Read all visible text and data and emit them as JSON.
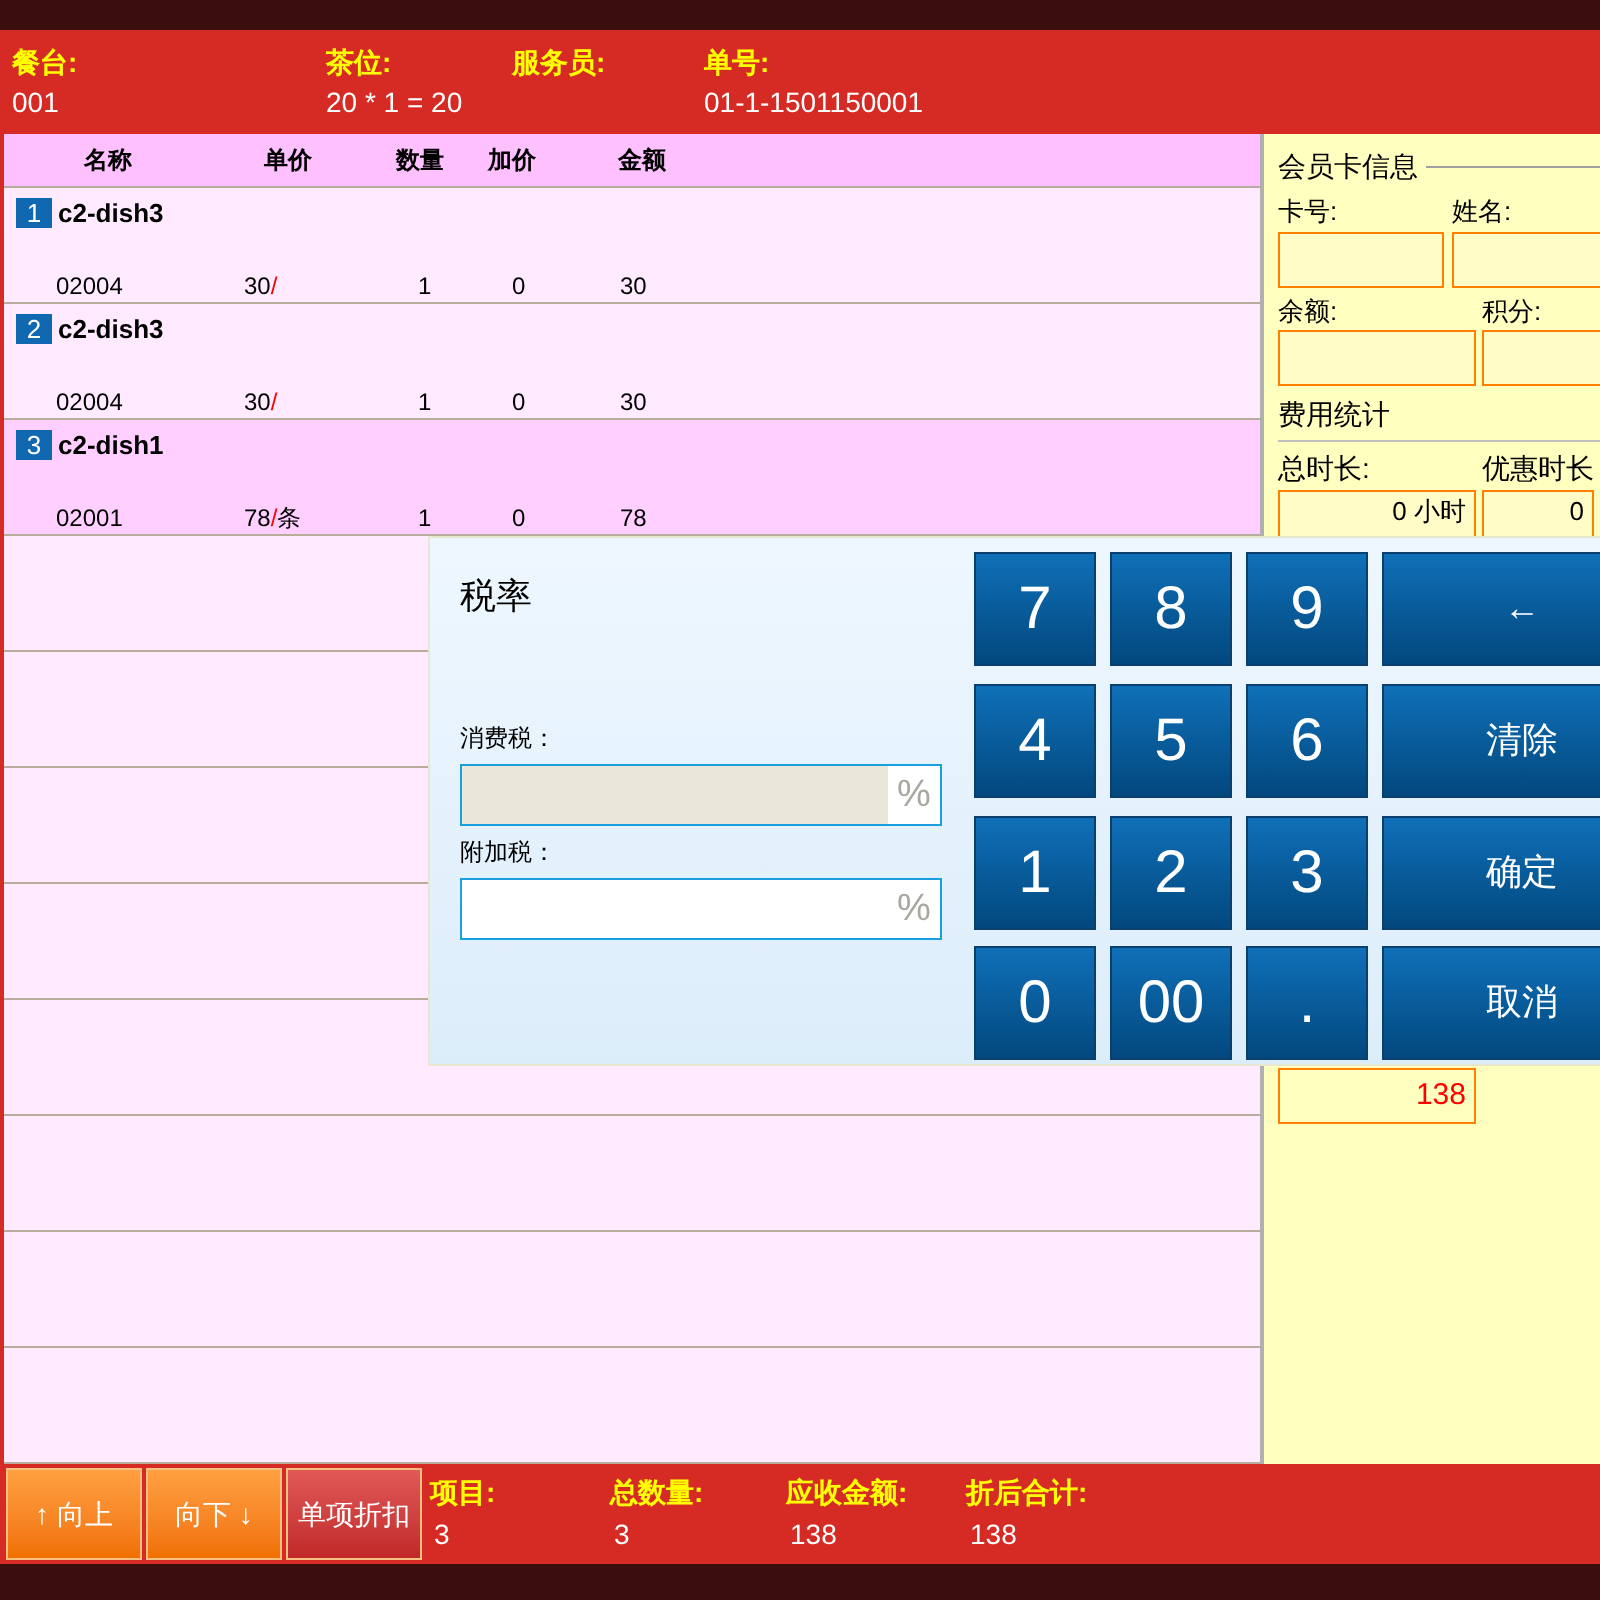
{
  "header": [
    {
      "label": "餐台:",
      "value": "001"
    },
    {
      "label": "茶位:",
      "value": "20 * 1 = 20"
    },
    {
      "label": "服务员:"
    },
    {
      "label": "单号:",
      "value": "01-1-1501150001"
    }
  ],
  "table": {
    "columns": [
      "名称",
      "单价",
      "数量",
      "加价",
      "金额"
    ],
    "rows": [
      {
        "index": "1",
        "name": "c2-dish3",
        "code": "02004",
        "price": "30",
        "sep": "/",
        "unit": "",
        "qty": "1",
        "extra": "0",
        "amount": "30",
        "selected": false
      },
      {
        "index": "2",
        "name": "c2-dish3",
        "code": "02004",
        "price": "30",
        "sep": "/",
        "unit": "",
        "qty": "1",
        "extra": "0",
        "amount": "30",
        "selected": false
      },
      {
        "index": "3",
        "name": "c2-dish1",
        "code": "02001",
        "price": "78",
        "sep": "/",
        "unit": "条",
        "qty": "1",
        "extra": "0",
        "amount": "78",
        "selected": true
      }
    ]
  },
  "member": {
    "title": "会员卡信息",
    "fields": [
      {
        "label": "卡号:"
      },
      {
        "label": "姓名:"
      },
      {
        "label": "余额:"
      },
      {
        "label": "积分:"
      }
    ]
  },
  "stats": {
    "title": "费用统计",
    "fields": [
      {
        "label": "总时长:",
        "value": "0 小时"
      },
      {
        "label": "优惠时长",
        "value": "0"
      }
    ],
    "total": "138"
  },
  "dialog": {
    "title": "税率",
    "fields": [
      {
        "label": "消费税：",
        "suffix": "%",
        "disabled": true
      },
      {
        "label": "附加税：",
        "suffix": "%",
        "disabled": false
      }
    ],
    "keys": [
      {
        "label": "7",
        "kind": "digit"
      },
      {
        "label": "8",
        "kind": "digit"
      },
      {
        "label": "9",
        "kind": "digit"
      },
      {
        "label": "←",
        "kind": "action"
      },
      {
        "label": "4",
        "kind": "digit"
      },
      {
        "label": "5",
        "kind": "digit"
      },
      {
        "label": "6",
        "kind": "digit"
      },
      {
        "label": "清除",
        "kind": "action"
      },
      {
        "label": "1",
        "kind": "digit"
      },
      {
        "label": "2",
        "kind": "digit"
      },
      {
        "label": "3",
        "kind": "digit"
      },
      {
        "label": "确定",
        "kind": "action"
      },
      {
        "label": "0",
        "kind": "digit"
      },
      {
        "label": "00",
        "kind": "digit"
      },
      {
        "label": ".",
        "kind": "digit"
      },
      {
        "label": "取消",
        "kind": "action"
      }
    ]
  },
  "buttons": [
    {
      "label": "↑ 向上",
      "kind": "nav"
    },
    {
      "label": "向下 ↓",
      "kind": "nav"
    },
    {
      "label": "单项折扣",
      "kind": "discount"
    }
  ],
  "summary": [
    {
      "label": "项目:",
      "value": "3"
    },
    {
      "label": "总数量:",
      "value": "3"
    },
    {
      "label": "应收金额:",
      "value": "138"
    },
    {
      "label": "折后合计:",
      "value": "138"
    }
  ]
}
